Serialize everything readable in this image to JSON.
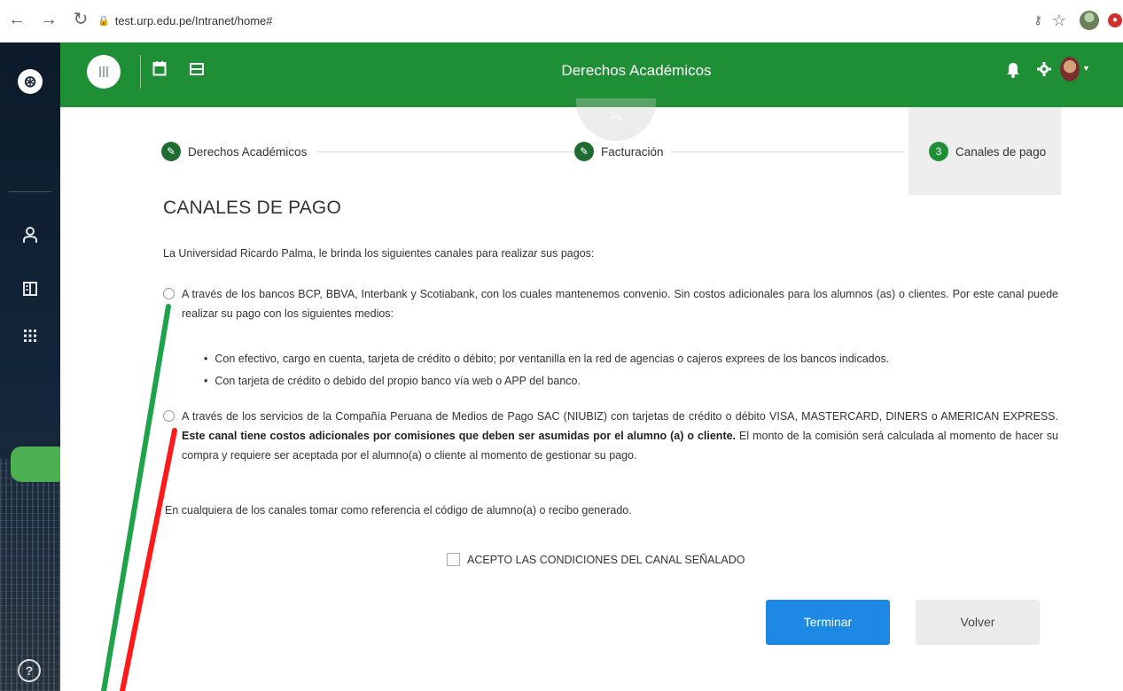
{
  "browser": {
    "url": "test.urp.edu.pe/Intranet/home#",
    "back_icon": "arrow-left-icon",
    "forward_icon": "arrow-right-icon",
    "reload_icon": "reload-icon",
    "lock_icon": "lock-icon",
    "key_icon": "key-icon",
    "star_icon": "star-icon"
  },
  "appbar": {
    "title": "Derechos Académicos",
    "background_color": "#1f8f36"
  },
  "stepper": {
    "steps": [
      {
        "label": "Derechos Académicos",
        "state": "done"
      },
      {
        "label": "Facturación",
        "state": "done"
      },
      {
        "label": "Canales de pago",
        "state": "active",
        "number": "3"
      }
    ]
  },
  "content": {
    "heading": "CANALES DE PAGO",
    "intro": "La Universidad Ricardo Palma, le brinda los siguientes canales para realizar sus pagos:",
    "option1": {
      "text": "A través de los bancos BCP, BBVA, Interbank y Scotiabank, con los cuales mantenemos convenio. Sin costos adicionales para los alumnos (as) o clientes. Por este canal puede realizar su pago con los siguientes medios:",
      "bullets": [
        "Con efectivo, cargo en cuenta, tarjeta de crédito o débito; por ventanilla en la red de agencias o cajeros exprees de los bancos indicados.",
        "Con tarjeta de crédito o debido del propio banco vía web o APP del banco."
      ]
    },
    "option2": {
      "text_before": "A través de los servicios de la Compañía Peruana de Medios de Pago SAC (NIUBIZ) con tarjetas de crédito o débito VISA, MASTERCARD, DINERS o AMERICAN EXPRESS. ",
      "text_bold": "Este canal tiene costos adicionales por comisiones que deben ser asumidas por el alumno (a) o cliente.",
      "text_after": " El monto de la comisión será calculada al momento de hacer su compra y requiere ser aceptada por el alumno(a) o cliente al momento de gestionar su pago."
    },
    "reference_note": "En cualquiera de los canales tomar como referencia el código de alumno(a) o recibo generado.",
    "accept_label": "ACEPTO LAS CONDICIONES DEL CANAL SEÑALADO"
  },
  "buttons": {
    "finish": "Terminar",
    "back": "Volver",
    "finish_color": "#1e88e5"
  },
  "annotation_colors": {
    "green": "#1fa34a",
    "red": "#ff1a1a"
  }
}
